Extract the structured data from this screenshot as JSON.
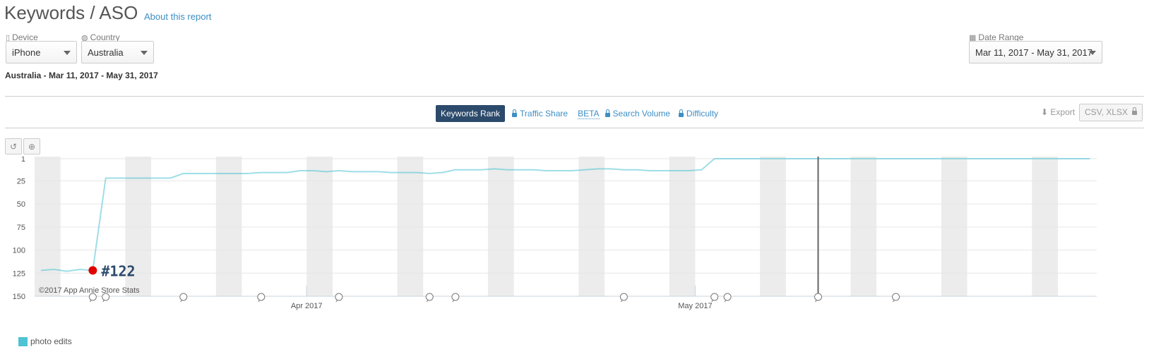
{
  "header": {
    "title": "Keywords / ASO",
    "about_link": "About this report"
  },
  "filters": {
    "device_label": "Device",
    "device_value": "iPhone",
    "country_label": "Country",
    "country_value": "Australia",
    "date_range_label": "Date Range",
    "date_range_value": "Mar 11, 2017 - May 31, 2017"
  },
  "subheading": "Australia - Mar 11, 2017 - May 31, 2017",
  "tabs": {
    "keywords_rank": "Keywords Rank",
    "traffic_share": "Traffic Share",
    "beta": "BETA",
    "search_volume": "Search Volume",
    "difficulty": "Difficulty"
  },
  "export": {
    "label": "Export",
    "button": "CSV, XLSX"
  },
  "icons": {
    "reset": "reset-zoom-icon",
    "zoom": "zoom-in-icon",
    "device": "mobile-icon",
    "country": "globe-icon",
    "calendar": "calendar-icon",
    "export": "download-icon",
    "lock": "lock-icon"
  },
  "colors": {
    "series": "#4fc3d4",
    "marker": "#e00000",
    "active_tab": "#2c4a6b",
    "link": "#3d8ec4"
  },
  "chart_data": {
    "type": "line",
    "y_axis": {
      "reversed": true,
      "ticks": [
        1,
        25,
        50,
        75,
        100,
        125,
        150
      ],
      "ylim": [
        1,
        150
      ]
    },
    "x_axis": {
      "range": [
        "2017-03-11",
        "2017-05-31"
      ],
      "tick_labels": [
        "Apr 2017",
        "May 2017"
      ],
      "tick_dates": [
        "2017-04-01",
        "2017-05-01"
      ]
    },
    "grid": true,
    "legend_position": "bottom-left",
    "credits": "©2017 App Annie Store Stats",
    "marker_label": "#122",
    "marker_point": {
      "date": "2017-03-15",
      "rank": 122
    },
    "cursor_date": "2017-05-10",
    "series": [
      {
        "name": "photo edits",
        "points": [
          [
            "2017-03-11",
            122
          ],
          [
            "2017-03-12",
            121
          ],
          [
            "2017-03-13",
            123
          ],
          [
            "2017-03-14",
            121
          ],
          [
            "2017-03-15",
            122
          ],
          [
            "2017-03-16",
            22
          ],
          [
            "2017-03-17",
            22
          ],
          [
            "2017-03-18",
            22
          ],
          [
            "2017-03-19",
            22
          ],
          [
            "2017-03-20",
            22
          ],
          [
            "2017-03-21",
            22
          ],
          [
            "2017-03-22",
            17
          ],
          [
            "2017-03-23",
            17
          ],
          [
            "2017-03-24",
            17
          ],
          [
            "2017-03-25",
            17
          ],
          [
            "2017-03-26",
            17
          ],
          [
            "2017-03-27",
            17
          ],
          [
            "2017-03-28",
            16
          ],
          [
            "2017-03-29",
            16
          ],
          [
            "2017-03-30",
            16
          ],
          [
            "2017-03-31",
            14
          ],
          [
            "2017-04-01",
            14
          ],
          [
            "2017-04-02",
            15
          ],
          [
            "2017-04-03",
            14
          ],
          [
            "2017-04-04",
            15
          ],
          [
            "2017-04-05",
            15
          ],
          [
            "2017-04-06",
            15
          ],
          [
            "2017-04-07",
            16
          ],
          [
            "2017-04-08",
            16
          ],
          [
            "2017-04-09",
            16
          ],
          [
            "2017-04-10",
            17
          ],
          [
            "2017-04-11",
            16
          ],
          [
            "2017-04-12",
            13
          ],
          [
            "2017-04-13",
            13
          ],
          [
            "2017-04-14",
            13
          ],
          [
            "2017-04-15",
            12
          ],
          [
            "2017-04-16",
            13
          ],
          [
            "2017-04-17",
            13
          ],
          [
            "2017-04-18",
            13
          ],
          [
            "2017-04-19",
            14
          ],
          [
            "2017-04-20",
            14
          ],
          [
            "2017-04-21",
            14
          ],
          [
            "2017-04-22",
            13
          ],
          [
            "2017-04-23",
            12
          ],
          [
            "2017-04-24",
            12
          ],
          [
            "2017-04-25",
            13
          ],
          [
            "2017-04-26",
            13
          ],
          [
            "2017-04-27",
            14
          ],
          [
            "2017-04-28",
            14
          ],
          [
            "2017-04-29",
            14
          ],
          [
            "2017-04-30",
            14
          ],
          [
            "2017-05-01",
            13
          ],
          [
            "2017-05-02",
            1
          ],
          [
            "2017-05-03",
            1
          ],
          [
            "2017-05-04",
            1
          ],
          [
            "2017-05-05",
            1
          ],
          [
            "2017-05-06",
            1
          ],
          [
            "2017-05-07",
            1
          ],
          [
            "2017-05-08",
            1
          ],
          [
            "2017-05-09",
            1
          ],
          [
            "2017-05-10",
            1
          ],
          [
            "2017-05-11",
            1
          ],
          [
            "2017-05-12",
            1
          ],
          [
            "2017-05-13",
            1
          ],
          [
            "2017-05-14",
            1
          ],
          [
            "2017-05-15",
            1
          ],
          [
            "2017-05-16",
            1
          ],
          [
            "2017-05-17",
            1
          ],
          [
            "2017-05-18",
            1
          ],
          [
            "2017-05-19",
            1
          ],
          [
            "2017-05-20",
            1
          ],
          [
            "2017-05-21",
            1
          ],
          [
            "2017-05-22",
            1
          ],
          [
            "2017-05-23",
            1
          ],
          [
            "2017-05-24",
            1
          ],
          [
            "2017-05-25",
            1
          ],
          [
            "2017-05-26",
            1
          ],
          [
            "2017-05-27",
            1
          ],
          [
            "2017-05-28",
            1
          ],
          [
            "2017-05-29",
            1
          ],
          [
            "2017-05-30",
            1
          ],
          [
            "2017-05-31",
            1
          ]
        ]
      }
    ],
    "event_marker_dates": [
      "2017-03-15",
      "2017-03-16",
      "2017-03-22",
      "2017-03-28",
      "2017-04-03",
      "2017-04-10",
      "2017-04-12",
      "2017-04-25",
      "2017-05-02",
      "2017-05-03",
      "2017-05-10",
      "2017-05-16"
    ],
    "weekend_start_dates": [
      "2017-03-11",
      "2017-03-18",
      "2017-03-25",
      "2017-04-01",
      "2017-04-08",
      "2017-04-15",
      "2017-04-22",
      "2017-04-29",
      "2017-05-06",
      "2017-05-13",
      "2017-05-20",
      "2017-05-27"
    ]
  }
}
